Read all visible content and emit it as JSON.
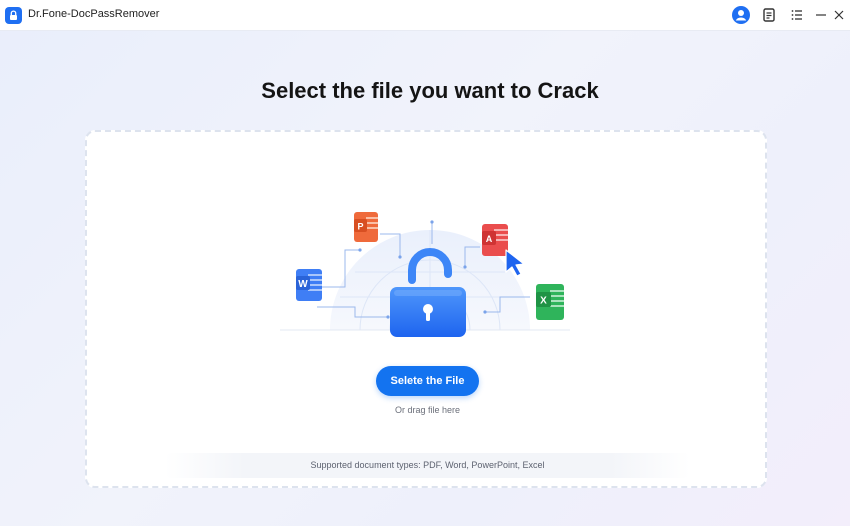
{
  "window": {
    "title": "Dr.Fone-DocPassRemover"
  },
  "titlebar_icons": [
    "app-logo-icon",
    "user-icon",
    "feedback-icon",
    "menu-icon",
    "minimize-icon",
    "close-icon"
  ],
  "main": {
    "heading": "Select the file you want to Crack",
    "select_button_label": "Selete the File",
    "drag_hint": "Or drag file here",
    "supported_types": "Supported document types: PDF, Word, PowerPoint, Excel"
  },
  "illustration": {
    "icons": [
      "word-file-icon",
      "powerpoint-file-icon",
      "pdf-file-icon",
      "excel-file-icon",
      "unlocked-padlock-icon",
      "cursor-arrow-icon"
    ],
    "letters": {
      "word": "W",
      "powerpoint": "P",
      "pdf": "A",
      "excel": "X"
    }
  },
  "colors": {
    "accent": "#1373f0",
    "word": "#3f7ef5",
    "powerpoint": "#ef6a3b",
    "pdf": "#ea4d4d",
    "excel": "#2fb45b"
  }
}
